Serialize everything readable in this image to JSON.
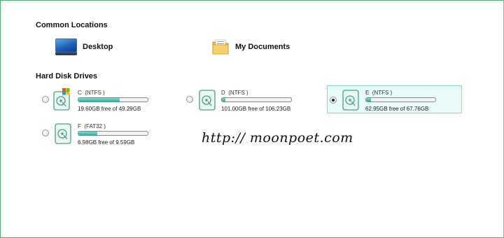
{
  "sections": {
    "common_locations": "Common Locations",
    "hard_disk_drives": "Hard Disk Drives"
  },
  "locations": [
    {
      "label": "Desktop",
      "icon": "desktop-icon"
    },
    {
      "label": "My Documents",
      "icon": "folder-icon"
    }
  ],
  "drives": [
    {
      "name": "C  (NTFS )",
      "free": "19.60GB free of 49.29GB",
      "used_fraction": 0.6,
      "selected": false,
      "system": true
    },
    {
      "name": "D  (NTFS )",
      "free": "101.00GB free of 106.23GB",
      "used_fraction": 0.05,
      "selected": false,
      "system": false
    },
    {
      "name": "E  (NTFS )",
      "free": "62.95GB free of 67.76GB",
      "used_fraction": 0.07,
      "selected": true,
      "system": false
    },
    {
      "name": "F  (FAT32 )",
      "free": "6.98GB free of 9.59GB",
      "used_fraction": 0.27,
      "selected": false,
      "system": false
    }
  ],
  "watermark": "http:// moonpoet.com",
  "colors": {
    "accent": "#2fb0a4",
    "selection_bg": "#e9fafb",
    "selection_border": "#8fd3da",
    "frame": "#4caf68"
  }
}
